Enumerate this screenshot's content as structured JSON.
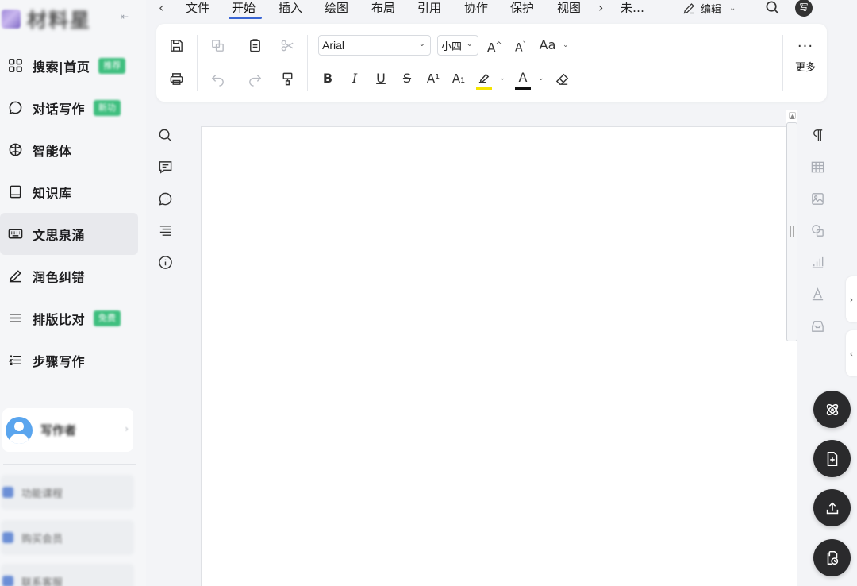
{
  "brand": {
    "name": "材料星"
  },
  "nav": {
    "items": [
      {
        "label": "搜索|首页",
        "badge": "推荐",
        "icon": "grid-icon"
      },
      {
        "label": "对话写作",
        "badge": "新功",
        "icon": "chat-icon"
      },
      {
        "label": "智能体",
        "badge": "",
        "icon": "agent-icon"
      },
      {
        "label": "知识库",
        "badge": "",
        "icon": "book-icon"
      },
      {
        "label": "文思泉涌",
        "badge": "",
        "icon": "keyboard-icon"
      },
      {
        "label": "润色纠错",
        "badge": "",
        "icon": "pen-icon"
      },
      {
        "label": "排版比对",
        "badge": "免费",
        "icon": "lines-icon"
      },
      {
        "label": "步骤写作",
        "badge": "",
        "icon": "numbered-list-icon"
      }
    ],
    "active_index": 4
  },
  "user": {
    "name": "写作者"
  },
  "bottom_links": [
    {
      "label": "功能课程"
    },
    {
      "label": "购买会员"
    },
    {
      "label": "联系客服"
    }
  ],
  "menubar": {
    "tabs": [
      "文件",
      "开始",
      "插入",
      "绘图",
      "布局",
      "引用",
      "协作",
      "保护",
      "视图",
      "未…"
    ],
    "active_tab": "开始",
    "edit_label": "编辑",
    "avatar_text": "写"
  },
  "ribbon": {
    "font_name": "Arial",
    "font_size": "小四",
    "grow_font": "A",
    "shrink_font": "A",
    "change_case": "Aa",
    "bold": "B",
    "italic": "I",
    "underline": "U",
    "strike": "S",
    "superscript": "A¹",
    "subscript": "A₁",
    "font_color": "A",
    "more_dots": "···",
    "more_label": "更多",
    "highlight_color": "#f5e400",
    "font_color_bar": "#111111"
  },
  "fabs": [
    "atom-icon",
    "new-doc-icon",
    "upload-icon",
    "history-doc-icon"
  ]
}
